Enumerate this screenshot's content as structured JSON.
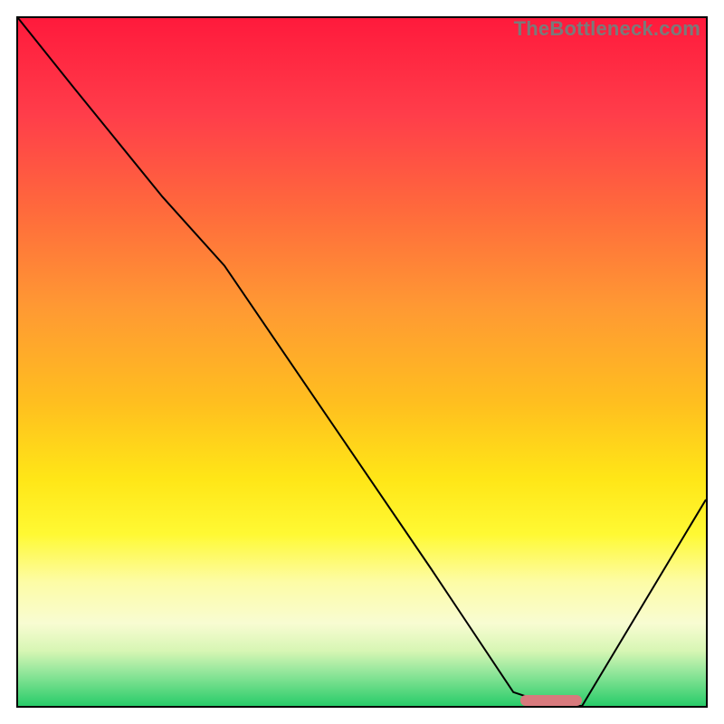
{
  "watermark": "TheBottleneck.com",
  "colors": {
    "gradient_top": "#ff1a3c",
    "gradient_mid": "#ffe617",
    "gradient_bottom": "#28cc69",
    "curve": "#000000",
    "marker": "#d87a7d",
    "border": "#000000"
  },
  "chart_data": {
    "type": "line",
    "title": "",
    "xlabel": "",
    "ylabel": "",
    "xlim": [
      0,
      100
    ],
    "ylim": [
      0,
      100
    ],
    "grid": false,
    "series": [
      {
        "name": "curve",
        "x": [
          0,
          8,
          21,
          30,
          45,
          60,
          72,
          78,
          82,
          100
        ],
        "y": [
          100,
          90,
          74,
          64,
          42,
          20,
          2,
          0,
          0,
          30
        ]
      }
    ],
    "marker": {
      "x_start": 73,
      "x_end": 82,
      "y": 0
    }
  }
}
